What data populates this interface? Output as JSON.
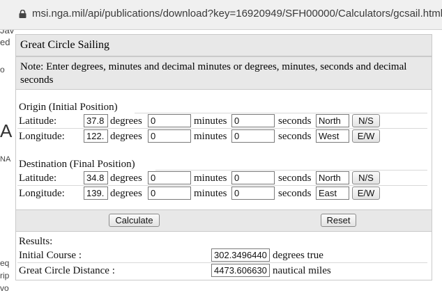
{
  "browser": {
    "url": "msi.nga.mil/api/publications/download?key=16920949/SFH00000/Calculators/gcsail.html"
  },
  "background_page": {
    "fragments": [
      "Jav",
      "ed",
      "o",
      "A",
      "NA",
      "eq",
      "rip",
      "vo"
    ]
  },
  "title": "Great Circle Sailing",
  "note": "Note: Enter degrees, minutes and decimal minutes or degrees, minutes, seconds and decimal seconds",
  "origin": {
    "heading": "Origin (Initial Position)",
    "latitude": {
      "label": "Latitude:",
      "degrees": "37.8",
      "minutes": "0",
      "seconds": "0",
      "hemisphere": "North",
      "toggle": "N/S"
    },
    "longitude": {
      "label": "Longitude:",
      "degrees": "122.",
      "minutes": "0",
      "seconds": "0",
      "hemisphere": "West",
      "toggle": "E/W"
    }
  },
  "destination": {
    "heading": "Destination (Final Position)",
    "latitude": {
      "label": "Latitude:",
      "degrees": "34.8",
      "minutes": "0",
      "seconds": "0",
      "hemisphere": "North",
      "toggle": "N/S"
    },
    "longitude": {
      "label": "Longitude:",
      "degrees": "139.",
      "minutes": "0",
      "seconds": "0",
      "hemisphere": "East",
      "toggle": "E/W"
    }
  },
  "units": {
    "degrees": "degrees",
    "minutes": "minutes",
    "seconds": "seconds"
  },
  "buttons": {
    "calculate": "Calculate",
    "reset": "Reset"
  },
  "results": {
    "heading": "Results:",
    "initial_course": {
      "label": "Initial Course :",
      "value": "302.3496440",
      "unit": "degrees true"
    },
    "distance": {
      "label": "Great Circle Distance :",
      "value": "4473.606630",
      "unit": "nautical miles"
    }
  }
}
